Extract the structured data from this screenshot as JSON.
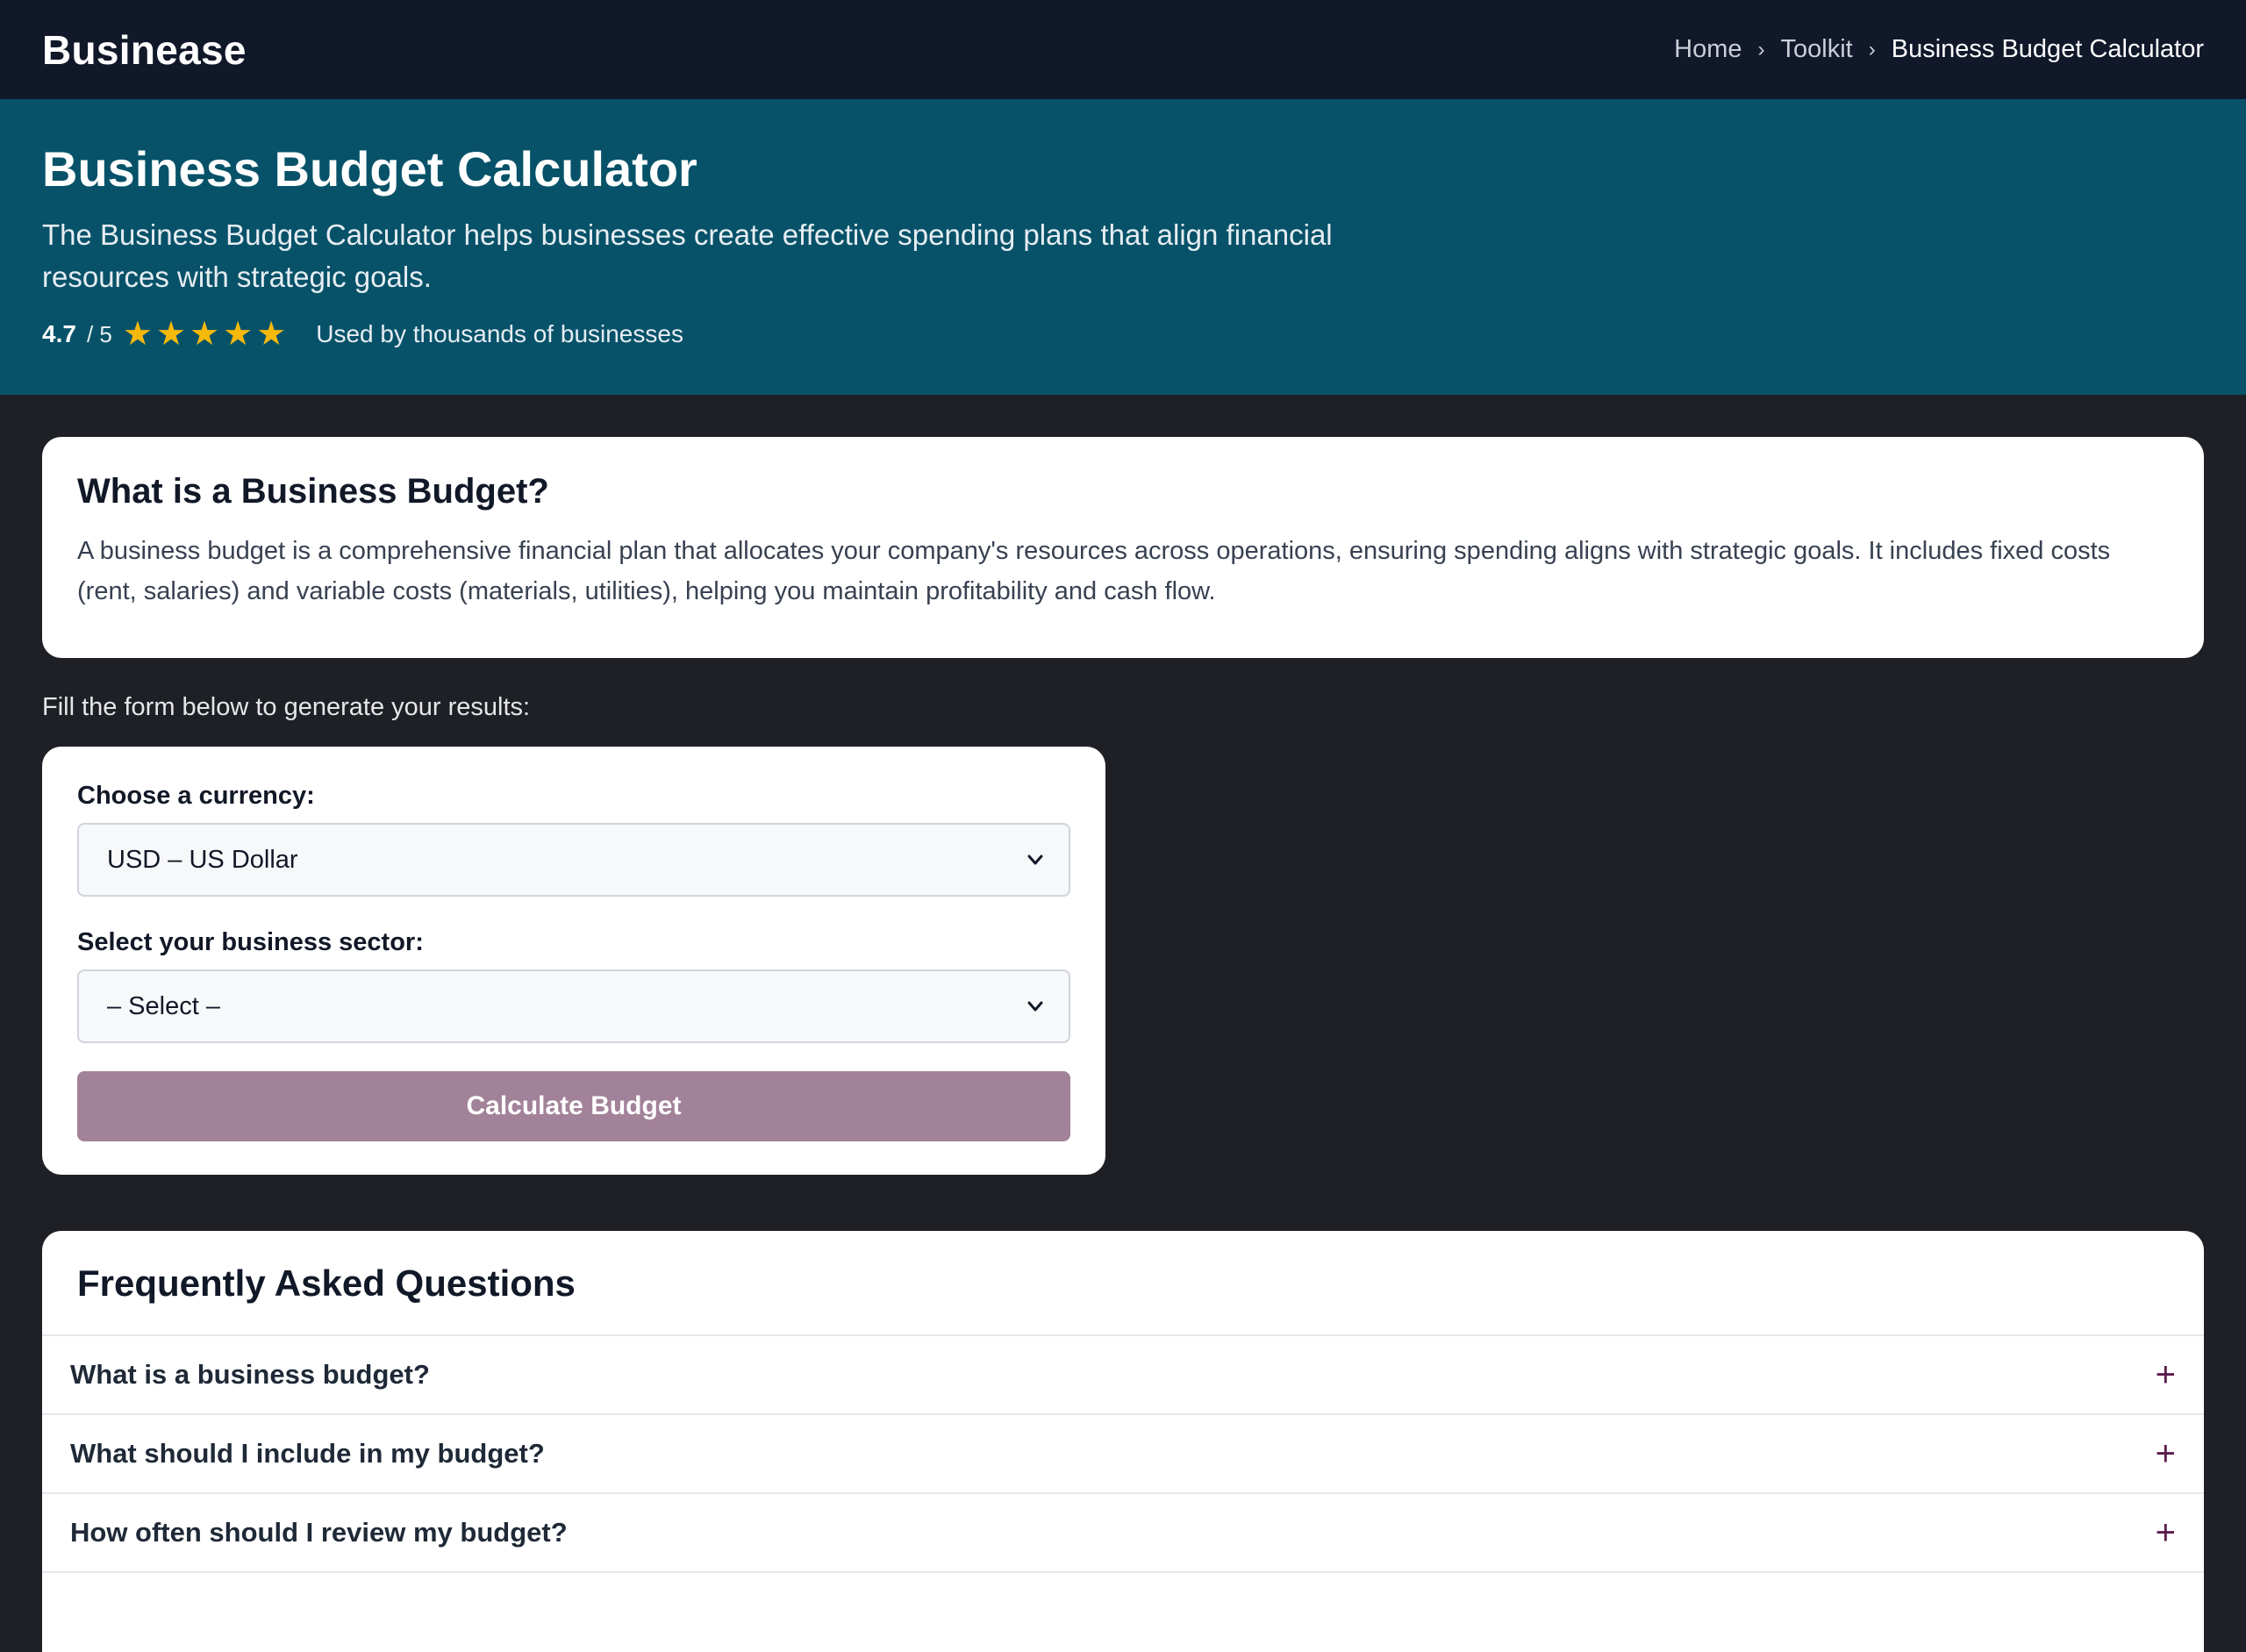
{
  "nav": {
    "logo": "Businease",
    "breadcrumb": [
      "Home",
      "Toolkit",
      "Business Budget Calculator"
    ],
    "separator": "›"
  },
  "hero": {
    "title": "Business Budget Calculator",
    "description": "The Business Budget Calculator helps businesses create effective spending plans that align financial resources with strategic goals.",
    "rating": "4.7",
    "rating_max": "/ 5",
    "stars": 5,
    "used_by": "Used by thousands of businesses"
  },
  "what": {
    "title": "What is a Business Budget?",
    "body": "A business budget is a comprehensive financial plan that allocates your company's resources across operations, ensuring spending aligns with strategic goals. It includes fixed costs (rent, salaries) and variable costs (materials, utilities), helping you maintain profitability and cash flow."
  },
  "form": {
    "intro": "Fill the form below to generate your results:",
    "currency_label": "Choose a currency:",
    "currency_value": "USD – US Dollar",
    "sector_label": "Select your business sector:",
    "sector_value": "– Select –",
    "submit_label": "Calculate Budget"
  },
  "faq": {
    "title": "Frequently Asked Questions",
    "items": [
      "What is a business budget?",
      "What should I include in my budget?",
      "How often should I review my budget?"
    ],
    "toggle_symbol": "+"
  },
  "colors": {
    "topbar": "#11182a",
    "hero": "#075269",
    "page": "#1f2025",
    "star": "#f5b80b",
    "button": "#a28299",
    "faq_toggle": "#5b1b4a"
  }
}
